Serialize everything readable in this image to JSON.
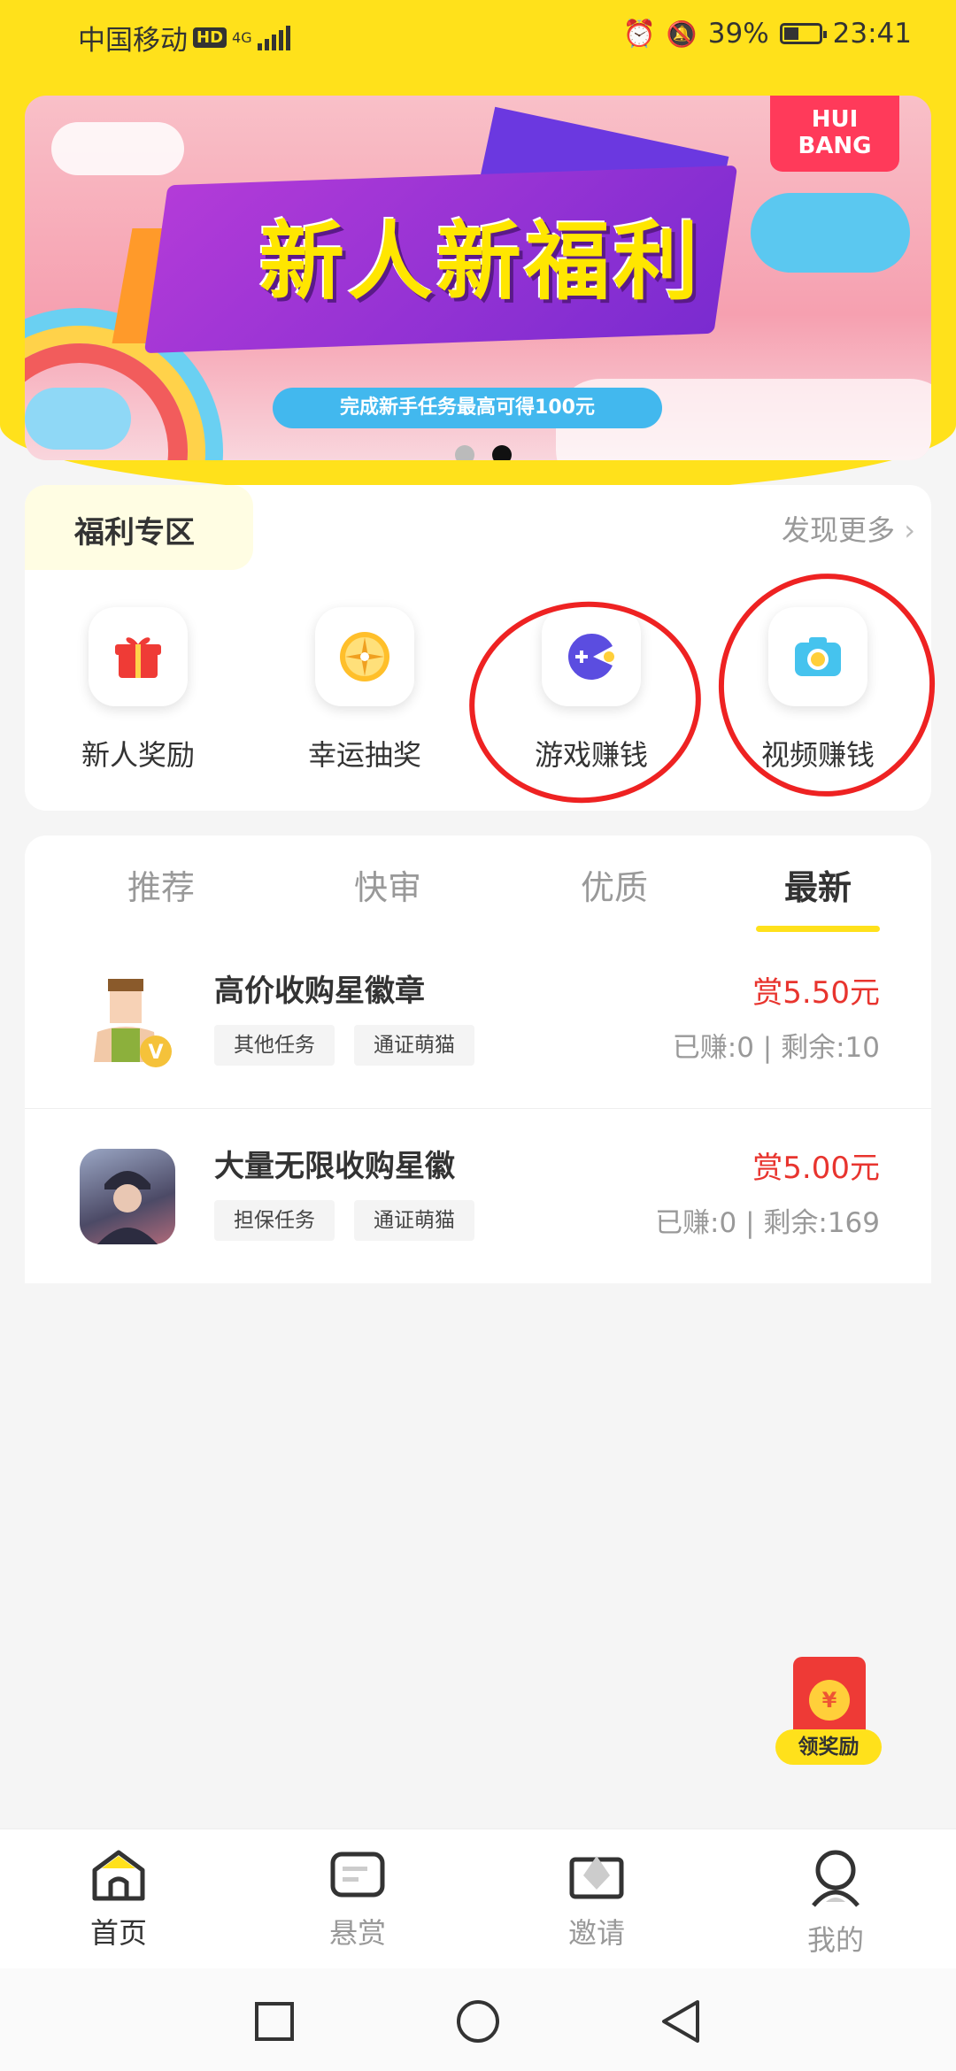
{
  "status_bar": {
    "carrier": "中国移动",
    "hd": "HD",
    "network": "4G",
    "battery": "39%",
    "time": "23:41"
  },
  "banner": {
    "brand": "HUI\nBANG",
    "title": "新人新福利",
    "subtitle": "完成新手任务最高可得100元"
  },
  "welfare": {
    "title": "福利专区",
    "more": "发现更多",
    "items": [
      {
        "label": "新人奖励",
        "icon": "gift-icon"
      },
      {
        "label": "幸运抽奖",
        "icon": "lucky-wheel-icon"
      },
      {
        "label": "游戏赚钱",
        "icon": "game-icon"
      },
      {
        "label": "视频赚钱",
        "icon": "camera-icon"
      }
    ]
  },
  "tabs": [
    {
      "label": "推荐"
    },
    {
      "label": "快审"
    },
    {
      "label": "优质"
    },
    {
      "label": "最新",
      "active": true
    }
  ],
  "tasks": [
    {
      "title": "高价收购星徽章",
      "tags": [
        "其他任务",
        "通证萌猫"
      ],
      "reward": "赏5.50元",
      "stats": "已赚:0 | 剩余:10",
      "avatar": "farmer-vip-avatar"
    },
    {
      "title": "大量无限收购星徽",
      "tags": [
        "担保任务",
        "通证萌猫"
      ],
      "reward": "赏5.00元",
      "stats": "已赚:0 | 剩余:169",
      "avatar": "person-photo-avatar"
    }
  ],
  "float_reward": {
    "coin": "¥",
    "label": "领奖励"
  },
  "bottom_nav": [
    {
      "label": "首页",
      "icon": "home-icon",
      "active": true
    },
    {
      "label": "悬赏",
      "icon": "bounty-icon"
    },
    {
      "label": "邀请",
      "icon": "invite-icon"
    },
    {
      "label": "我的",
      "icon": "profile-icon"
    }
  ],
  "colors": {
    "brand_yellow": "#ffe11b",
    "reward_red": "#e8342e",
    "annotation_red": "#ee2222"
  }
}
